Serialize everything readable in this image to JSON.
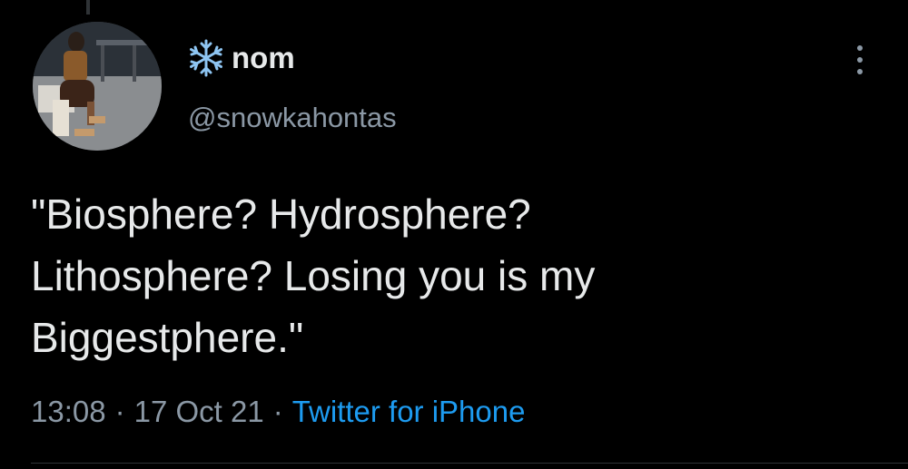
{
  "tweet": {
    "author": {
      "display_name": "nom",
      "name_emoji_icon": "snowflake-icon",
      "handle": "@snowkahontas",
      "avatar": "profile-photo"
    },
    "more_icon": "more-dots-vertical-icon",
    "text_lines": [
      "\"Biosphere? Hydrosphere?",
      "Lithosphere? Losing you is my",
      "Biggestphere.\""
    ],
    "meta": {
      "time": "13:08",
      "separator": "·",
      "date": "17 Oct 21",
      "source": "Twitter for iPhone"
    }
  },
  "colors": {
    "background": "#000000",
    "primary_text": "#e7e9ea",
    "secondary_text": "#8b98a5",
    "link": "#1d9bf0",
    "snowflake": "#8ec5f2"
  }
}
